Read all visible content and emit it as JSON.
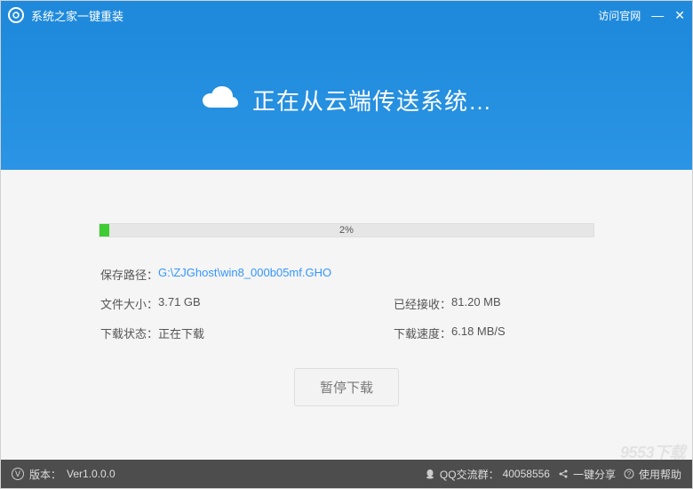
{
  "titlebar": {
    "title": "系统之家一键重装",
    "visit_official": "访问官网",
    "min": "—",
    "close": "✕"
  },
  "header": {
    "heading": "正在从云端传送系统…"
  },
  "progress": {
    "percent_text": "2%",
    "percent_value": 2
  },
  "info": {
    "save_path_label": "保存路径：",
    "save_path_value": "G:\\ZJGhost\\win8_000b05mf.GHO",
    "file_size_label": "文件大小：",
    "file_size_value": "3.71 GB",
    "received_label": "已经接收：",
    "received_value": "81.20 MB",
    "status_label": "下载状态：",
    "status_value": "正在下载",
    "speed_label": "下载速度：",
    "speed_value": "6.18 MB/S"
  },
  "buttons": {
    "pause": "暂停下载"
  },
  "footer": {
    "version_label": "版本：",
    "version_value": "Ver1.0.0.0",
    "qq_label": "QQ交流群：",
    "qq_value": "40058556",
    "share": "一键分享",
    "help": "使用帮助"
  },
  "watermark": "9553下载"
}
